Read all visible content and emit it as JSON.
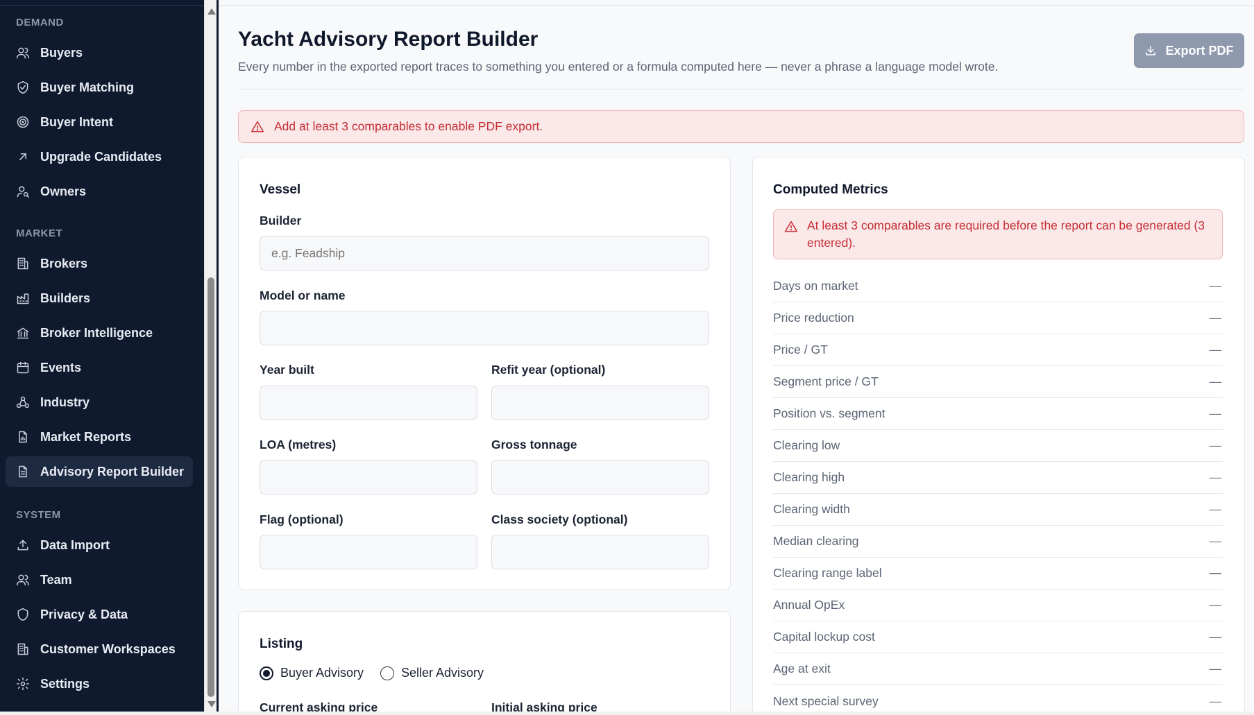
{
  "sidebar": {
    "sections": [
      {
        "label": "DEMAND"
      },
      {
        "label": "MARKET"
      },
      {
        "label": "SYSTEM"
      }
    ],
    "items": [
      {
        "label": "Buyers",
        "icon": "users-icon"
      },
      {
        "label": "Buyer Matching",
        "icon": "shield-check-icon"
      },
      {
        "label": "Buyer Intent",
        "icon": "target-icon"
      },
      {
        "label": "Upgrade Candidates",
        "icon": "arrow-up-right-icon"
      },
      {
        "label": "Owners",
        "icon": "user-search-icon"
      },
      {
        "label": "Brokers",
        "icon": "building-icon"
      },
      {
        "label": "Builders",
        "icon": "factory-icon"
      },
      {
        "label": "Broker Intelligence",
        "icon": "landmark-icon"
      },
      {
        "label": "Events",
        "icon": "calendar-icon"
      },
      {
        "label": "Industry",
        "icon": "network-icon"
      },
      {
        "label": "Market Reports",
        "icon": "file-chart-icon"
      },
      {
        "label": "Advisory Report Builder",
        "icon": "file-text-icon",
        "active": true
      },
      {
        "label": "Data Import",
        "icon": "upload-icon"
      },
      {
        "label": "Team",
        "icon": "users-icon"
      },
      {
        "label": "Privacy & Data",
        "icon": "shield-icon"
      },
      {
        "label": "Customer Workspaces",
        "icon": "building-icon"
      },
      {
        "label": "Settings",
        "icon": "gear-icon"
      }
    ]
  },
  "header": {
    "title": "Yacht Advisory Report Builder",
    "subtitle": "Every number in the exported report traces to something you entered or a formula computed here — never a phrase a language model wrote.",
    "export_label": "Export PDF"
  },
  "alert_top": "Add at least 3 comparables to enable PDF export.",
  "vessel": {
    "title": "Vessel",
    "builder_label": "Builder",
    "builder_placeholder": "e.g. Feadship",
    "model_label": "Model or name",
    "year_label": "Year built",
    "refit_label": "Refit year (optional)",
    "loa_label": "LOA (metres)",
    "gt_label": "Gross tonnage",
    "flag_label": "Flag (optional)",
    "class_label": "Class society (optional)"
  },
  "listing": {
    "title": "Listing",
    "radio_buyer": "Buyer Advisory",
    "radio_seller": "Seller Advisory",
    "selected": "Buyer Advisory",
    "current_price_label": "Current asking price",
    "initial_price_label": "Initial asking price"
  },
  "metrics": {
    "title": "Computed Metrics",
    "alert": "At least 3 comparables are required before the report can be generated (3 entered).",
    "rows": [
      {
        "label": "Days on market",
        "value": "—"
      },
      {
        "label": "Price reduction",
        "value": "—"
      },
      {
        "label": "Price / GT",
        "value": "—"
      },
      {
        "label": "Segment price / GT",
        "value": "—"
      },
      {
        "label": "Position vs. segment",
        "value": "—"
      },
      {
        "label": "Clearing low",
        "value": "—"
      },
      {
        "label": "Clearing high",
        "value": "—"
      },
      {
        "label": "Clearing width",
        "value": "—"
      },
      {
        "label": "Median clearing",
        "value": "—"
      },
      {
        "label": "Clearing range label",
        "value": "—"
      },
      {
        "label": "Annual OpEx",
        "value": "—"
      },
      {
        "label": "Capital lockup cost",
        "value": "—"
      },
      {
        "label": "Age at exit",
        "value": "—"
      },
      {
        "label": "Next special survey",
        "value": "—"
      }
    ]
  },
  "colors": {
    "sidebar_bg": "#0f1a2e",
    "alert_text": "#c62d33",
    "alert_bg": "#fbe9ea",
    "export_button": "#8e99ad"
  }
}
